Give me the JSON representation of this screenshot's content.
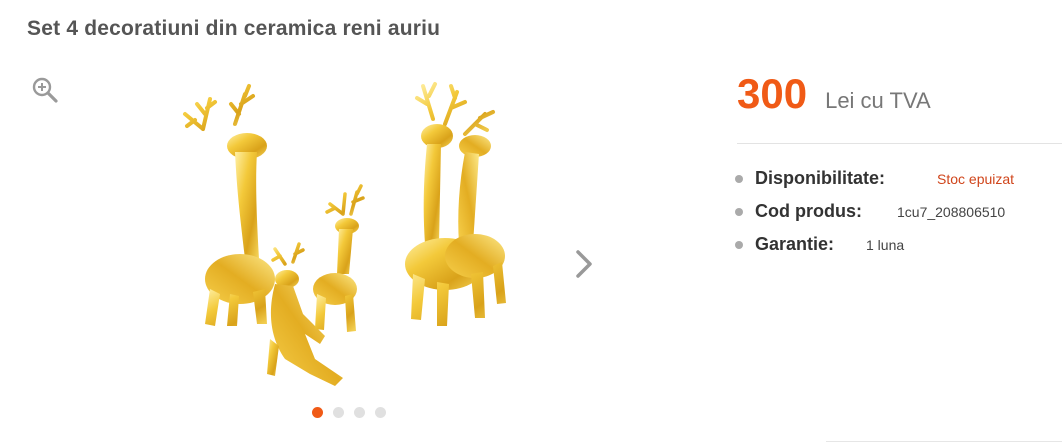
{
  "product": {
    "title": "Set 4 decoratiuni din ceramica reni auriu"
  },
  "gallery": {
    "image_alt": "Set 4 decoratiuni din ceramica reni auriu",
    "slide_count": 4,
    "active_slide": 1,
    "icons": {
      "zoom": "zoom-in-icon",
      "next": "chevron-right-icon"
    }
  },
  "price": {
    "value": "300",
    "unit": "Lei cu TVA"
  },
  "specs": [
    {
      "label": "Disponibilitate:",
      "value": "Stoc epuizat"
    },
    {
      "label": "Cod produs:",
      "value": "1cu7_208806510"
    },
    {
      "label": "Garantie:",
      "value": "1 luna"
    }
  ],
  "colors": {
    "accent": "#f05a16",
    "stock_out": "#d0451b",
    "gold": "#e8b824"
  }
}
